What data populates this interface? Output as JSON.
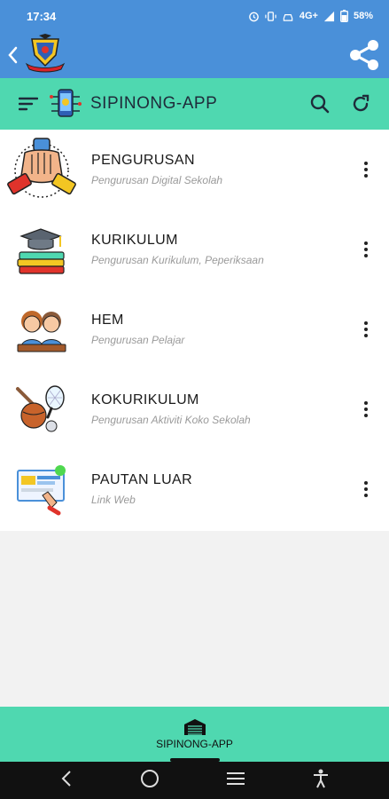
{
  "status_bar": {
    "time": "17:34",
    "network": "4G+",
    "battery": "58%"
  },
  "app_bar": {
    "title": "SIPINONG-APP"
  },
  "items": [
    {
      "title": "PENGURUSAN",
      "subtitle": "Pengurusan Digital Sekolah",
      "icon": "handshake-icon"
    },
    {
      "title": "KURIKULUM",
      "subtitle": "Pengurusan Kurikulum, Peperiksaan",
      "icon": "books-graduation-cap-icon"
    },
    {
      "title": "HEM",
      "subtitle": "Pengurusan Pelajar",
      "icon": "students-icon"
    },
    {
      "title": "KOKURIKULUM",
      "subtitle": "Pengurusan Aktiviti Koko Sekolah",
      "icon": "sports-equipment-icon"
    },
    {
      "title": "PAUTAN LUAR",
      "subtitle": "Link Web",
      "icon": "web-link-icon"
    }
  ],
  "bottom_nav": {
    "label": "SIPINONG-APP"
  },
  "colors": {
    "status_bar": "#4a90d9",
    "app_bar": "#4fd8b0",
    "background": "#f2f2f2"
  }
}
